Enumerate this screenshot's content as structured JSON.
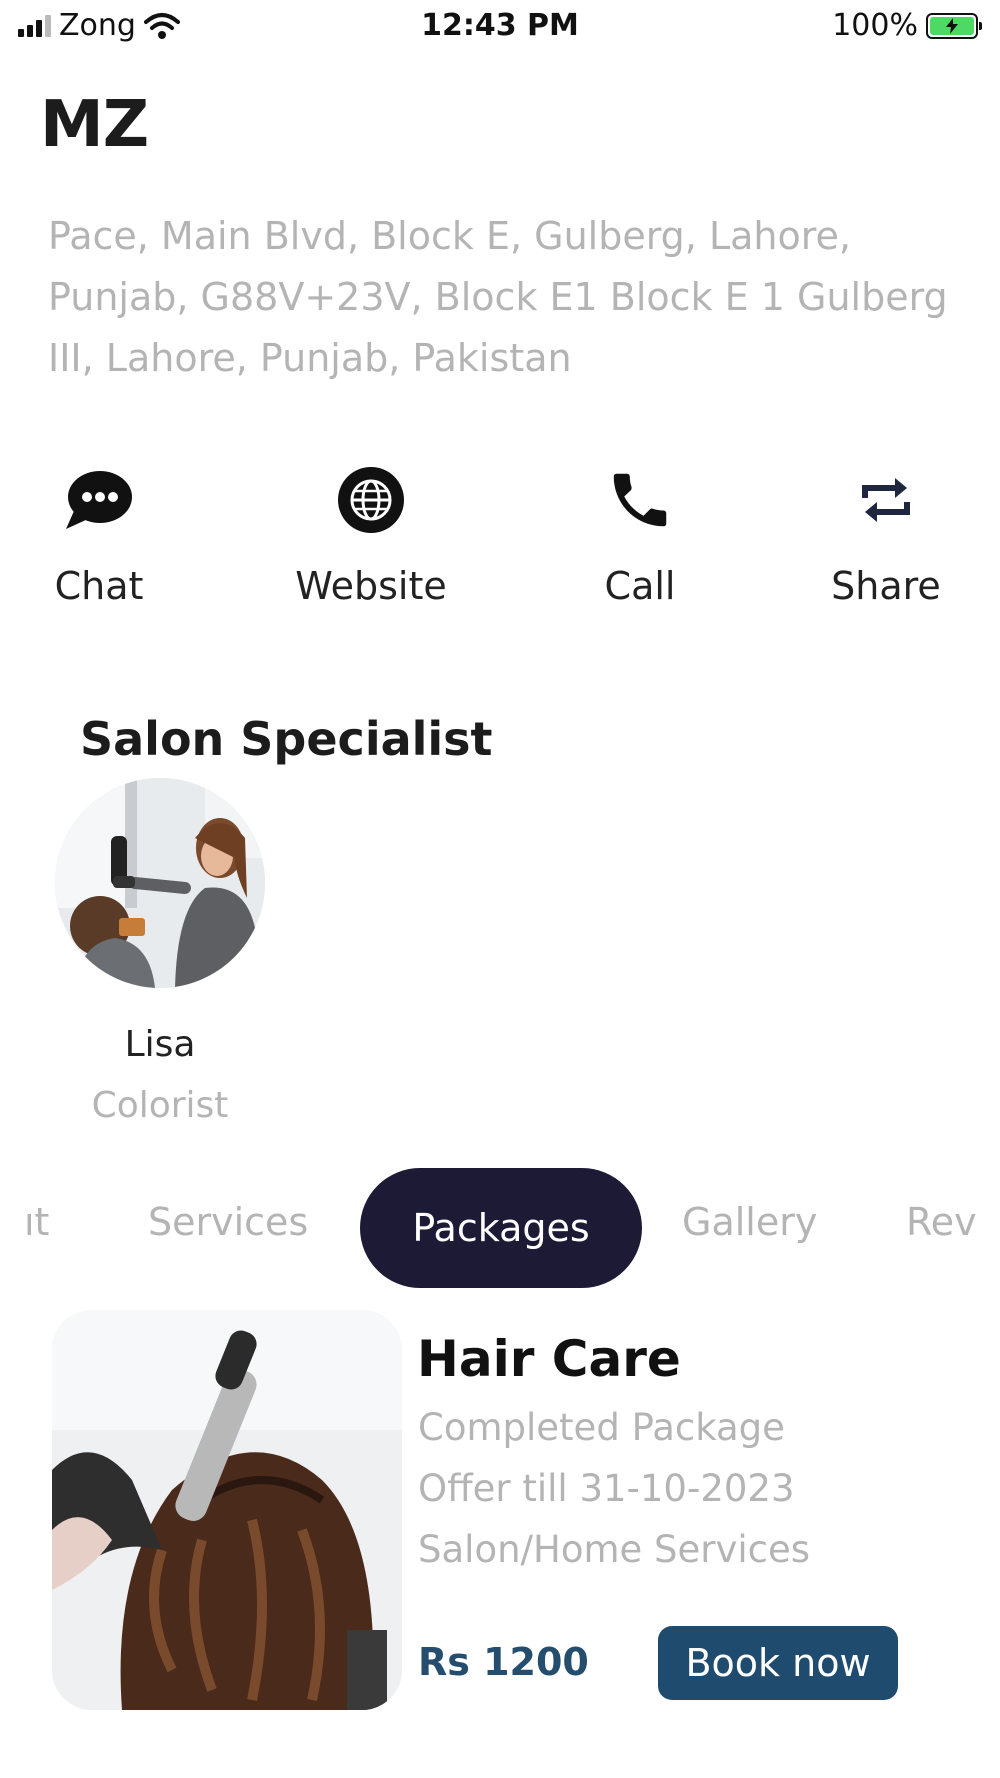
{
  "status_bar": {
    "carrier": "Zong",
    "time": "12:43 PM",
    "battery": "100%",
    "battery_color": "#4cd964"
  },
  "business": {
    "name": "MZ",
    "address": "Pace, Main Blvd, Block E, Gulberg, Lahore, Punjab, G88V+23V, Block E1 Block E 1 Gulberg III, Lahore, Punjab, Pakistan"
  },
  "actions": [
    {
      "label": "Chat",
      "icon": "chat-bubble-icon"
    },
    {
      "label": "Website",
      "icon": "globe-icon"
    },
    {
      "label": "Call",
      "icon": "phone-icon"
    },
    {
      "label": "Share",
      "icon": "share-icon"
    }
  ],
  "specialists": {
    "title": "Salon Specialist",
    "items": [
      {
        "name": "Lisa",
        "role": "Colorist",
        "image": "stylist-blow-drying-photo"
      }
    ]
  },
  "tabs": {
    "items": [
      "ıt",
      "Services",
      "Packages",
      "Gallery",
      "Rev"
    ],
    "active": "Packages",
    "active_color": "#1d1a36"
  },
  "package": {
    "image": "hair-curling-photo",
    "title": "Hair Care",
    "line1": "Completed Package",
    "line2": "Offer till 31-10-2023",
    "line3": "Salon/Home Services",
    "price": "Rs 1200",
    "book_label": "Book now",
    "button_color": "#1f4b6e"
  }
}
